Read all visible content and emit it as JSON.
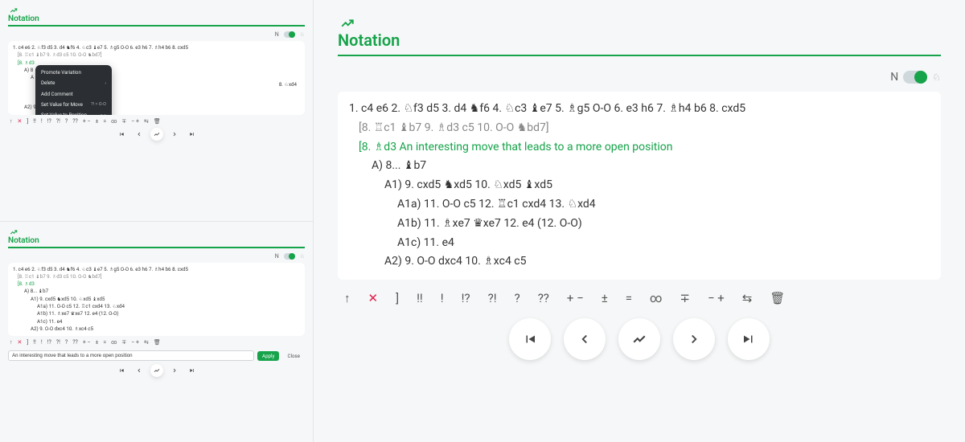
{
  "title": "Notation",
  "toggle_label": "N",
  "knight_glyph": "♘",
  "context_menu": {
    "promote": "Promote Variation",
    "delete": "Delete",
    "add_comment": "Add Comment",
    "set_value_move": "Set Value for Move",
    "set_value_move_kbd": "?! > O-O",
    "set_value_position": "Set Value to Position",
    "set_value_position_kbd": "= >"
  },
  "comment_input": {
    "value": "An interesting move that leads to a more open position",
    "apply": "Apply",
    "close": "Close"
  },
  "moves": {
    "main": "1. c4  e6   2. ♘f3  d5   3. d4  ♞f6   4. ♘c3  ♝e7   5. ♗g5  O-O   6. e3  h6   7. ♗h4  b6   8. cxd5",
    "var1": "[8. ♖c1  ♝b7   9. ♗d3  c5   10. O-O  ♞bd7]",
    "var2_open": "[8. ♗d3 An interesting move that leads to a more open position",
    "var2_open_short": "[8. ♗d3",
    "A": "A) 8... ♝b7",
    "A1": "A1) 9. cxd5  ♞xd5   10. ♘xd5  ♝xd5",
    "A1a": "A1a) 11. O-O  c5   12. ♖c1  cxd4   13. ♘xd4",
    "A1b": "A1b) 11. ♗xe7  ♛xe7   12. e4 (12. O-O)",
    "A1c": "A1c) 11. e4",
    "A2": "A2) 9. O-O  dxc4   10. ♗xc4  c5",
    "truncated_behind_menu": "8. ♘xd4"
  },
  "anno": {
    "up": "↑",
    "x": "✕",
    "bracket": "]",
    "dbl_excl": "!!",
    "excl": "!",
    "excl_q": "!?",
    "q_excl": "?!",
    "q": "?",
    "dbl_q": "??",
    "plus_minus": "+ −",
    "plus_minus_sign": "±",
    "eq": "=",
    "inf": "∞",
    "minus_plus_sign": "∓",
    "minus_plus": "− +",
    "swap": "⇆",
    "trash": "🗑"
  }
}
